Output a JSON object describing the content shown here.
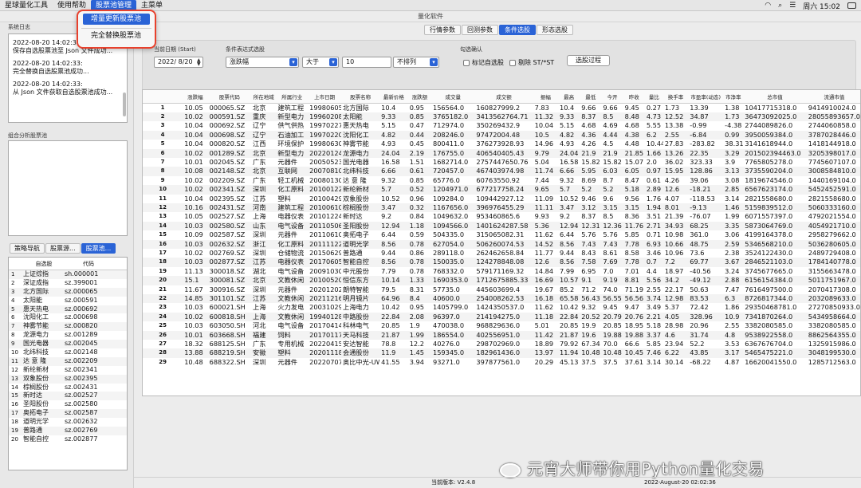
{
  "menubar": {
    "app_name": "星球量化工具",
    "items": [
      "使用帮助",
      "股票池管理",
      "主菜单"
    ],
    "clock": "周六 15:02"
  },
  "dropdown": {
    "items": [
      "增量更新股票池",
      "完全替换股票池"
    ]
  },
  "window": {
    "title": "量化软件"
  },
  "left": {
    "log_title": "系统日志",
    "logs": [
      {
        "time": "2022-08-20 14:02:33:",
        "msg": "保存自选股票池至 Json 文件成功..."
      },
      {
        "time": "2022-08-20 14:02:33:",
        "msg": "完全替换自选股票池成功..."
      },
      {
        "time": "2022-08-20 14:02:33:",
        "msg": "从 Json 文件获取自选股票池成功..."
      }
    ],
    "combo_title": "组合分析股票池",
    "tabs": [
      "策略导航",
      "股票源...",
      "股票池..."
    ],
    "stock_table": {
      "headers": [
        "",
        "自选股",
        "代码"
      ],
      "rows": [
        [
          "1",
          "上证综指",
          "sh.000001"
        ],
        [
          "2",
          "深证成指",
          "sz.399001"
        ],
        [
          "3",
          "北方国际",
          "sz.000065"
        ],
        [
          "4",
          "太阳能",
          "sz.000591"
        ],
        [
          "5",
          "惠天热电",
          "sz.000692"
        ],
        [
          "6",
          "沈阳化工",
          "sz.000698"
        ],
        [
          "7",
          "神雾节能",
          "sz.000820"
        ],
        [
          "8",
          "龙源电力",
          "sz.001289"
        ],
        [
          "9",
          "国光电器",
          "sz.002045"
        ],
        [
          "10",
          "北纬科技",
          "sz.002148"
        ],
        [
          "11",
          "达 意 隆",
          "sz.002209"
        ],
        [
          "12",
          "新纶新材",
          "sz.002341"
        ],
        [
          "13",
          "双象股份",
          "sz.002395"
        ],
        [
          "14",
          "棕榈股份",
          "sz.002431"
        ],
        [
          "15",
          "新时达",
          "sz.002527"
        ],
        [
          "16",
          "圣阳股份",
          "sz.002580"
        ],
        [
          "17",
          "奥拓电子",
          "sz.002587"
        ],
        [
          "18",
          "道明光学",
          "sz.002632"
        ],
        [
          "19",
          "普路通",
          "sz.002769"
        ],
        [
          "20",
          "智能自控",
          "sz.002877"
        ]
      ]
    }
  },
  "main": {
    "tabs": [
      "行情参数",
      "回测参数",
      "条件选股",
      "形态选股"
    ],
    "active_tab": 2,
    "filter": {
      "date_label": "当前日期 (Start)",
      "date_value": "2022/ 8/20",
      "expr_label": "条件表达式选股",
      "field_value": "涨跌幅",
      "op_value": "大于",
      "num_value": "10",
      "sort_value": "不排列",
      "confirm_label": "勾选确认",
      "check1": "标记自选股",
      "check2": "剔除 ST/*ST",
      "button": "选股过程"
    },
    "table": {
      "headers": [
        "",
        "涨跌幅",
        "股票代码",
        "所在地域",
        "所属行业",
        "上市日期",
        "股票名称",
        "最新价格",
        "涨跌额",
        "成交量",
        "成交额",
        "振幅",
        "最高",
        "最低",
        "今开",
        "昨收",
        "量比",
        "换手率",
        "市盈率(动态)",
        "市净率",
        "总市值",
        "流通市值"
      ],
      "rows": [
        [
          "1",
          "10.05",
          "000065.SZ",
          "北京",
          "建筑工程",
          "19980605",
          "北方国际",
          "10.4",
          "0.95",
          "156564.0",
          "160827999.2",
          "7.83",
          "10.4",
          "9.66",
          "9.66",
          "9.45",
          "0.27",
          "1.73",
          "13.39",
          "1.38",
          "10417715318.0",
          "9414910024.0"
        ],
        [
          "2",
          "10.02",
          "000591.SZ",
          "重庆",
          "新型电力",
          "19960208",
          "太阳能",
          "9.33",
          "0.85",
          "3765182.0",
          "3413562764.71",
          "11.32",
          "9.33",
          "8.37",
          "8.5",
          "8.48",
          "4.73",
          "12.52",
          "34.87",
          "1.73",
          "36473092025.0",
          "28055893657.0"
        ],
        [
          "3",
          "10.04",
          "000692.SZ",
          "辽宁",
          "供气供热",
          "19970227",
          "惠天热电",
          "5.15",
          "0.47",
          "712974.0",
          "350269432.9",
          "10.04",
          "5.15",
          "4.68",
          "4.69",
          "4.68",
          "5.55",
          "13.38",
          "-0.99",
          "-4.38",
          "2744089826.0",
          "2744060858.0"
        ],
        [
          "4",
          "10.04",
          "000698.SZ",
          "辽宁",
          "石油加工",
          "19970220",
          "沈阳化工",
          "4.82",
          "0.44",
          "208246.0",
          "97472004.48",
          "10.5",
          "4.82",
          "4.36",
          "4.44",
          "4.38",
          "6.2",
          "2.55",
          "-6.84",
          "0.99",
          "3950059384.0",
          "3787028446.0"
        ],
        [
          "5",
          "10.04",
          "000820.SZ",
          "江西",
          "环境保护",
          "19980630",
          "神雾节能",
          "4.93",
          "0.45",
          "800411.0",
          "376273928.93",
          "14.96",
          "4.93",
          "4.26",
          "4.5",
          "4.48",
          "10.44",
          "27.83",
          "-283.82",
          "38.31",
          "3141618944.0",
          "1418144918.0"
        ],
        [
          "6",
          "10.02",
          "001289.SZ",
          "北京",
          "新型电力",
          "20220124",
          "龙源电力",
          "24.04",
          "2.19",
          "176755.0",
          "406540405.43",
          "9.79",
          "24.04",
          "21.9",
          "21.9",
          "21.85",
          "1.66",
          "13.26",
          "22.35",
          "3.29",
          "201502394463.0",
          "3205398017.0"
        ],
        [
          "7",
          "10.01",
          "002045.SZ",
          "广东",
          "元器件",
          "20050523",
          "国光电器",
          "16.58",
          "1.51",
          "1682714.0",
          "2757447650.76",
          "5.04",
          "16.58",
          "15.82",
          "15.82",
          "15.07",
          "2.0",
          "36.02",
          "323.33",
          "3.9",
          "7765805278.0",
          "7745607107.0"
        ],
        [
          "8",
          "10.08",
          "002148.SZ",
          "北京",
          "互联网",
          "20070810",
          "北纬科技",
          "6.66",
          "0.61",
          "720457.0",
          "467403974.98",
          "11.74",
          "6.66",
          "5.95",
          "6.03",
          "6.05",
          "0.97",
          "15.95",
          "128.86",
          "3.13",
          "3735590204.0",
          "3008584810.0"
        ],
        [
          "9",
          "10.02",
          "002209.SZ",
          "广东",
          "轻工机械",
          "20080130",
          "达 意 隆",
          "9.32",
          "0.85",
          "65776.0",
          "60763550.92",
          "7.44",
          "9.32",
          "8.69",
          "8.7",
          "8.47",
          "0.61",
          "4.26",
          "39.06",
          "3.08",
          "1819674546.0",
          "1440169104.0"
        ],
        [
          "10",
          "10.02",
          "002341.SZ",
          "深圳",
          "化工原料",
          "20100122",
          "新纶新材",
          "5.7",
          "0.52",
          "1204971.0",
          "677217758.24",
          "9.65",
          "5.7",
          "5.2",
          "5.2",
          "5.18",
          "2.89",
          "12.6",
          "-18.21",
          "2.85",
          "6567623174.0",
          "5452452591.0"
        ],
        [
          "11",
          "10.04",
          "002395.SZ",
          "江苏",
          "塑料",
          "20100429",
          "双象股份",
          "10.52",
          "0.96",
          "109284.0",
          "109442927.12",
          "11.09",
          "10.52",
          "9.46",
          "9.6",
          "9.56",
          "1.76",
          "4.07",
          "-118.53",
          "3.14",
          "2821558680.0",
          "2821558680.0"
        ],
        [
          "12",
          "10.16",
          "002431.SZ",
          "河南",
          "建筑工程",
          "20100610",
          "棕榈股份",
          "3.47",
          "0.32",
          "1167656.0",
          "396976455.29",
          "11.11",
          "3.47",
          "3.12",
          "3.15",
          "3.15",
          "1.94",
          "8.01",
          "-9.13",
          "1.46",
          "5159839512.0",
          "5060333160.0"
        ],
        [
          "13",
          "10.05",
          "002527.SZ",
          "上海",
          "电器仪表",
          "20101224",
          "新时达",
          "9.2",
          "0.84",
          "1049632.0",
          "953460865.6",
          "9.93",
          "9.2",
          "8.37",
          "8.5",
          "8.36",
          "3.51",
          "21.39",
          "-76.07",
          "1.99",
          "6071557397.0",
          "4792021554.0"
        ],
        [
          "14",
          "10.03",
          "002580.SZ",
          "山东",
          "电气设备",
          "20110506",
          "圣阳股份",
          "12.94",
          "1.18",
          "1094566.0",
          "1401624287.58",
          "5.36",
          "12.94",
          "12.31",
          "12.36",
          "11.76",
          "2.71",
          "34.93",
          "68.25",
          "3.35",
          "5873064769.0",
          "4054921710.0"
        ],
        [
          "15",
          "10.09",
          "002587.SZ",
          "深圳",
          "元器件",
          "20110610",
          "奥拓电子",
          "6.44",
          "0.59",
          "504335.0",
          "315065082.31",
          "11.62",
          "6.44",
          "5.76",
          "5.76",
          "5.85",
          "0.71",
          "10.98",
          "361.0",
          "3.06",
          "4199164378.0",
          "2958279662.0"
        ],
        [
          "16",
          "10.03",
          "002632.SZ",
          "浙江",
          "化工原料",
          "20111122",
          "道明光学",
          "8.56",
          "0.78",
          "627054.0",
          "506260074.53",
          "14.52",
          "8.56",
          "7.43",
          "7.43",
          "7.78",
          "6.93",
          "10.66",
          "48.75",
          "2.59",
          "5346568210.0",
          "5036280605.0"
        ],
        [
          "17",
          "10.02",
          "002769.SZ",
          "深圳",
          "仓储物流",
          "20150629",
          "普路通",
          "9.44",
          "0.86",
          "289118.0",
          "262462658.84",
          "11.77",
          "9.44",
          "8.43",
          "8.61",
          "8.58",
          "3.46",
          "10.96",
          "73.6",
          "2.38",
          "3524122430.0",
          "2489729408.0"
        ],
        [
          "18",
          "10.03",
          "002877.SZ",
          "江苏",
          "电器仪表",
          "20170605",
          "智能自控",
          "8.56",
          "0.78",
          "150035.0",
          "124278848.08",
          "12.6",
          "8.56",
          "7.58",
          "7.69",
          "7.78",
          "0.7",
          "7.2",
          "69.77",
          "3.67",
          "2846521103.0",
          "1784140778.0"
        ],
        [
          "19",
          "11.13",
          "300018.SZ",
          "湖北",
          "电气设备",
          "20091030",
          "中元股份",
          "7.79",
          "0.78",
          "768332.0",
          "579171169.32",
          "14.84",
          "7.99",
          "6.95",
          "7.0",
          "7.01",
          "4.4",
          "18.97",
          "-40.56",
          "3.24",
          "3745677665.0",
          "3155663478.0"
        ],
        [
          "20",
          "15.1",
          "300081.SZ",
          "北京",
          "文教休闲",
          "20100520",
          "恒信东方",
          "10.14",
          "1.33",
          "1690353.0",
          "1712675885.33",
          "16.69",
          "10.57",
          "9.1",
          "9.19",
          "8.81",
          "5.56",
          "34.2",
          "-49.12",
          "2.88",
          "6156154384.0",
          "5011751967.0"
        ],
        [
          "21",
          "11.67",
          "300916.SZ",
          "深圳",
          "元器件",
          "20201202",
          "朗特智能",
          "79.5",
          "8.31",
          "57735.0",
          "445603699.4",
          "19.67",
          "85.2",
          "71.2",
          "74.0",
          "71.19",
          "2.55",
          "22.17",
          "50.63",
          "7.47",
          "7616497500.0",
          "2070417308.0"
        ],
        [
          "22",
          "14.85",
          "301101.SZ",
          "江苏",
          "文教休闲",
          "20211216",
          "明月镜片",
          "64.96",
          "8.4",
          "40600.0",
          "254008262.53",
          "16.18",
          "65.58",
          "56.43",
          "56.55",
          "56.56",
          "3.74",
          "12.98",
          "83.53",
          "6.3",
          "8726817344.0",
          "2032089633.0"
        ],
        [
          "23",
          "10.03",
          "600021.SH",
          "上海",
          "火力发电",
          "20031029",
          "上海电力",
          "10.42",
          "0.95",
          "1405799.0",
          "1424350537.0",
          "11.62",
          "10.42",
          "9.32",
          "9.45",
          "9.47",
          "3.49",
          "5.37",
          "72.42",
          "1.86",
          "29350468781.0",
          "27270850933.0"
        ],
        [
          "24",
          "10.02",
          "600818.SH",
          "上海",
          "文教休闲",
          "19940128",
          "中路股份",
          "22.84",
          "2.08",
          "96397.0",
          "214194275.0",
          "11.18",
          "22.84",
          "20.52",
          "20.79",
          "20.76",
          "2.21",
          "4.05",
          "328.96",
          "10.9",
          "7341870264.0",
          "5434958664.0"
        ],
        [
          "25",
          "10.03",
          "603050.SH",
          "河北",
          "电气设备",
          "20170414",
          "科林电气",
          "20.85",
          "1.9",
          "470038.0",
          "968829636.0",
          "5.01",
          "20.85",
          "19.9",
          "20.85",
          "18.95",
          "5.18",
          "28.98",
          "20.96",
          "2.55",
          "3382080585.0",
          "3382080585.0"
        ],
        [
          "26",
          "10.01",
          "603668.SH",
          "福建",
          "饲料",
          "20170117",
          "天马科技",
          "21.87",
          "1.99",
          "186554.0",
          "402556951.0",
          "11.42",
          "21.87",
          "19.6",
          "19.88",
          "19.88",
          "3.37",
          "4.6",
          "31.74",
          "4.8",
          "9538922558.0",
          "8862564355.0"
        ],
        [
          "27",
          "18.32",
          "688125.SH",
          "广东",
          "专用机械",
          "20220415",
          "安达智能",
          "78.8",
          "12.2",
          "40276.0",
          "298702969.0",
          "18.89",
          "79.92",
          "67.34",
          "70.0",
          "66.6",
          "5.85",
          "23.94",
          "52.2",
          "3.53",
          "6367676704.0",
          "1325915986.0"
        ],
        [
          "28",
          "13.88",
          "688219.SH",
          "安徽",
          "塑料",
          "20201118",
          "会通股份",
          "11.9",
          "1.45",
          "159345.0",
          "182961436.0",
          "13.97",
          "11.94",
          "10.48",
          "10.48",
          "10.45",
          "7.46",
          "6.22",
          "43.85",
          "3.17",
          "5465475221.0",
          "3048199530.0"
        ],
        [
          "29",
          "10.48",
          "688322.SH",
          "深圳",
          "元器件",
          "20220707",
          "奥比中光-UW",
          "41.55",
          "3.94",
          "93271.0",
          "397877561.0",
          "20.29",
          "45.13",
          "37.5",
          "37.5",
          "37.61",
          "3.14",
          "30.14",
          "-68.22",
          "4.87",
          "16620041550.0",
          "1285712563.0"
        ]
      ]
    }
  },
  "status": {
    "version": "当前版本: V2.4.8",
    "time": "2022-August-20 02:02:36"
  },
  "watermark": "元宵大师带你用Python量化交易"
}
